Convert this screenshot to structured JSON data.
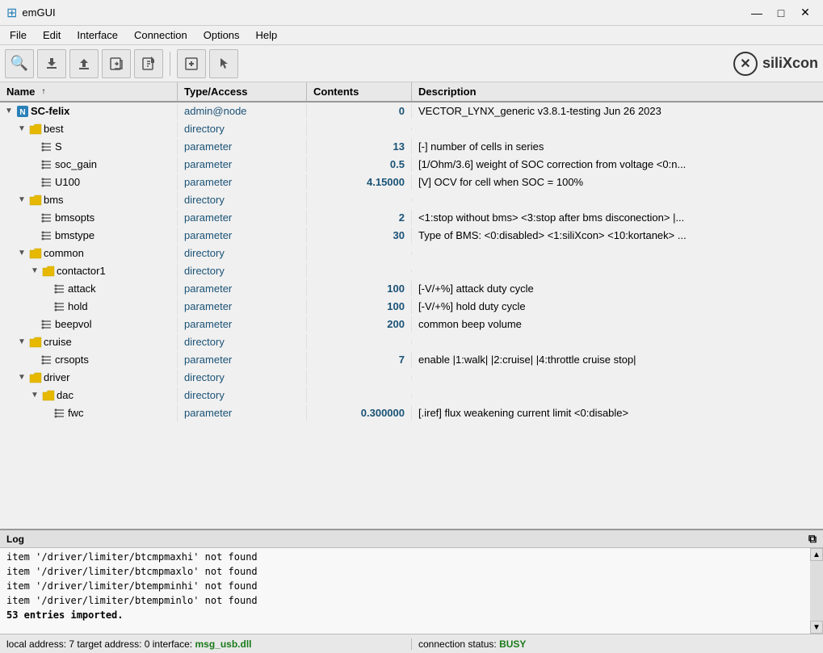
{
  "titleBar": {
    "appIcon": "⊞",
    "title": "emGUI",
    "minimize": "—",
    "maximize": "□",
    "close": "✕"
  },
  "menuBar": {
    "items": [
      "File",
      "Edit",
      "Interface",
      "Connection",
      "Options",
      "Help"
    ]
  },
  "toolbar": {
    "buttons": [
      {
        "name": "search",
        "icon": "🔍"
      },
      {
        "name": "download",
        "icon": "⬇"
      },
      {
        "name": "upload",
        "icon": "⬆"
      },
      {
        "name": "import",
        "icon": "📂"
      },
      {
        "name": "export",
        "icon": "📤"
      },
      {
        "name": "add",
        "icon": "📋"
      },
      {
        "name": "pointer",
        "icon": "👆"
      }
    ],
    "logo": "siliXcon"
  },
  "tableHeader": {
    "name": "Name",
    "sortArrow": "↑",
    "type": "Type/Access",
    "contents": "Contents",
    "description": "Description"
  },
  "treeRows": [
    {
      "id": "root",
      "indent": 0,
      "expand": "▼",
      "icon": "root",
      "label": "SC-felix",
      "type": "admin@node",
      "contents": "0",
      "desc": "VECTOR_LYNX_generic v3.8.1-testing Jun 26 2023"
    },
    {
      "id": "best",
      "indent": 1,
      "expand": "▼",
      "icon": "folder",
      "label": "best",
      "type": "directory",
      "contents": "",
      "desc": ""
    },
    {
      "id": "S",
      "indent": 2,
      "expand": "",
      "icon": "param",
      "label": "S",
      "type": "parameter",
      "contents": "13",
      "desc": "[-] number of cells in series"
    },
    {
      "id": "soc_gain",
      "indent": 2,
      "expand": "",
      "icon": "param",
      "label": "soc_gain",
      "type": "parameter",
      "contents": "0.5",
      "desc": "[1/Ohm/3.6] weight of SOC correction from voltage <0:n..."
    },
    {
      "id": "U100",
      "indent": 2,
      "expand": "",
      "icon": "param",
      "label": "U100",
      "type": "parameter",
      "contents": "4.15000",
      "desc": "[V] OCV for cell when SOC = 100%"
    },
    {
      "id": "bms",
      "indent": 1,
      "expand": "▼",
      "icon": "folder",
      "label": "bms",
      "type": "directory",
      "contents": "",
      "desc": ""
    },
    {
      "id": "bmsopts",
      "indent": 2,
      "expand": "",
      "icon": "param",
      "label": "bmsopts",
      "type": "parameter",
      "contents": "2",
      "desc": "<1:stop without bms> <3:stop after bms disconection> |..."
    },
    {
      "id": "bmstype",
      "indent": 2,
      "expand": "",
      "icon": "param",
      "label": "bmstype",
      "type": "parameter",
      "contents": "30",
      "desc": "Type of BMS: <0:disabled> <1:siliXcon> <10:kortanek> ..."
    },
    {
      "id": "common",
      "indent": 1,
      "expand": "▼",
      "icon": "folder",
      "label": "common",
      "type": "directory",
      "contents": "",
      "desc": ""
    },
    {
      "id": "contactor1",
      "indent": 2,
      "expand": "▼",
      "icon": "folder",
      "label": "contactor1",
      "type": "directory",
      "contents": "",
      "desc": ""
    },
    {
      "id": "attack",
      "indent": 3,
      "expand": "",
      "icon": "param",
      "label": "attack",
      "type": "parameter",
      "contents": "100",
      "desc": "[-V/+%] attack duty cycle"
    },
    {
      "id": "hold",
      "indent": 3,
      "expand": "",
      "icon": "param",
      "label": "hold",
      "type": "parameter",
      "contents": "100",
      "desc": "[-V/+%] hold duty cycle"
    },
    {
      "id": "beepvol",
      "indent": 2,
      "expand": "",
      "icon": "param",
      "label": "beepvol",
      "type": "parameter",
      "contents": "200",
      "desc": "common beep volume"
    },
    {
      "id": "cruise",
      "indent": 1,
      "expand": "▼",
      "icon": "folder",
      "label": "cruise",
      "type": "directory",
      "contents": "",
      "desc": ""
    },
    {
      "id": "crsopts",
      "indent": 2,
      "expand": "",
      "icon": "param",
      "label": "crsopts",
      "type": "parameter",
      "contents": "7",
      "desc": "enable |1:walk| |2:cruise| |4:throttle cruise stop|"
    },
    {
      "id": "driver",
      "indent": 1,
      "expand": "▼",
      "icon": "folder",
      "label": "driver",
      "type": "directory",
      "contents": "",
      "desc": ""
    },
    {
      "id": "dac",
      "indent": 2,
      "expand": "▼",
      "icon": "folder",
      "label": "dac",
      "type": "directory",
      "contents": "",
      "desc": ""
    },
    {
      "id": "fwc",
      "indent": 3,
      "expand": "",
      "icon": "param",
      "label": "fwc",
      "type": "parameter",
      "contents": "0.300000",
      "desc": "[.iref] flux weakening current limit <0:disable>"
    }
  ],
  "log": {
    "title": "Log",
    "lines": [
      "item '/driver/limiter/btcmpmaxhi' not found",
      "item '/driver/limiter/btcmpmaxlo' not found",
      "item '/driver/limiter/btempminhi' not found",
      "item '/driver/limiter/btempminlo' not found",
      "53 entries imported."
    ]
  },
  "statusBar": {
    "left": "local address: 7  target address: 0  interface: ",
    "interface": "msg_usb.dll",
    "right": "connection status: ",
    "connectionStatus": "BUSY"
  }
}
